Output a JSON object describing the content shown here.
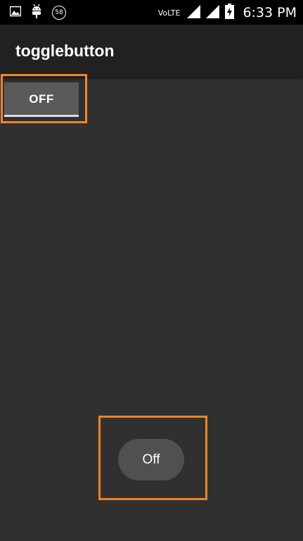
{
  "status_bar": {
    "notification_icons": [
      "image-icon",
      "android-debug-icon",
      "badge-icon"
    ],
    "badge_count": "58",
    "network_label": "VoLTE",
    "time": "6:33 PM"
  },
  "app_bar": {
    "title": "togglebutton"
  },
  "toggles": [
    {
      "label": "OFF",
      "checked": false,
      "style": "classic"
    },
    {
      "label": "Off",
      "checked": false,
      "style": "pill"
    }
  ],
  "colors": {
    "highlight": "#f5841f",
    "background": "#303030",
    "app_bar": "#212121",
    "status_bar": "#000000"
  }
}
